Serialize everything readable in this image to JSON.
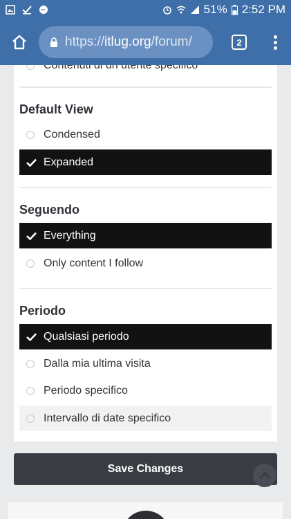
{
  "status_bar": {
    "battery": "51%",
    "time": "2:52 PM"
  },
  "browser": {
    "url_prefix": "https://",
    "url_host": "itlug.org",
    "url_path": "/forum/",
    "tab_count": "2"
  },
  "partial_item": {
    "label": "Contenuti di un utente specifico"
  },
  "sections": [
    {
      "title": "Default View",
      "options": [
        {
          "label": "Condensed",
          "selected": false
        },
        {
          "label": "Expanded",
          "selected": true
        }
      ]
    },
    {
      "title": "Seguendo",
      "options": [
        {
          "label": "Everything",
          "selected": true
        },
        {
          "label": "Only content I follow",
          "selected": false
        }
      ]
    },
    {
      "title": "Periodo",
      "options": [
        {
          "label": "Qualsiasi periodo",
          "selected": true
        },
        {
          "label": "Dalla mia ultima visita",
          "selected": false
        },
        {
          "label": "Periodo specifico",
          "selected": false
        },
        {
          "label": "Intervallo di date specifico",
          "selected": false
        }
      ]
    }
  ],
  "actions": {
    "save_label": "Save Changes"
  },
  "colors": {
    "browser_bar": "#3f6fa8",
    "selected_bg": "#121212",
    "save_button": "#3a3c43"
  }
}
